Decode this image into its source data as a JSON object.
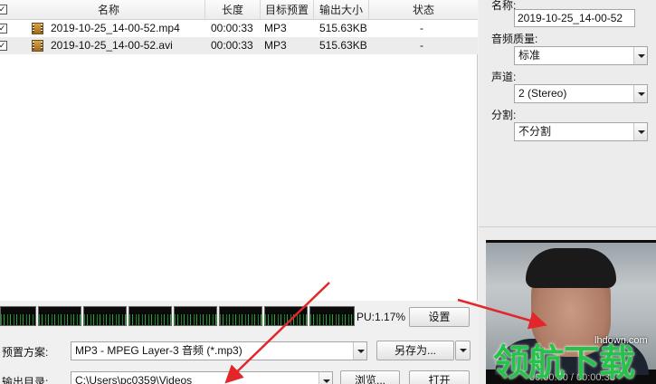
{
  "file_list": {
    "columns": [
      "名称",
      "长度",
      "目标预置",
      "输出大小",
      "状态"
    ],
    "rows": [
      {
        "checked": "✓",
        "name": "2019-10-25_14-00-52.mp4",
        "length": "00:00:33",
        "preset": "MP3",
        "size": "515.63KB",
        "status": "-"
      },
      {
        "checked": "✓",
        "name": "2019-10-25_14-00-52.avi",
        "length": "00:00:33",
        "preset": "MP3",
        "size": "515.63KB",
        "status": "-"
      }
    ]
  },
  "meter": {
    "cpu_label": "PU:",
    "cpu_value": "1.17%"
  },
  "buttons": {
    "settings": "设置",
    "save_as": "另存为...",
    "browse": "浏览...",
    "open": "打开"
  },
  "preset": {
    "label": "预置方案:",
    "value": "MP3 - MPEG Layer-3 音频 (*.mp3)"
  },
  "output_dir": {
    "label": "输出目录:",
    "value": "C:\\Users\\pc0359\\Videos"
  },
  "right_panel": {
    "name_label": "名称:",
    "name_value": "2019-10-25_14-00-52",
    "quality_label": "音频质量:",
    "quality_value": "标准",
    "channel_label": "声道:",
    "channel_value": "2 (Stereo)",
    "split_label": "分割:",
    "split_value": "不分割"
  },
  "preview": {
    "timecode": "00:00:00 / 00:00:33"
  },
  "watermark": {
    "url": "lhdown.com",
    "text": "领航下载"
  },
  "colors": {
    "arrow": "#e2262a",
    "watermark": "#27c24a"
  }
}
